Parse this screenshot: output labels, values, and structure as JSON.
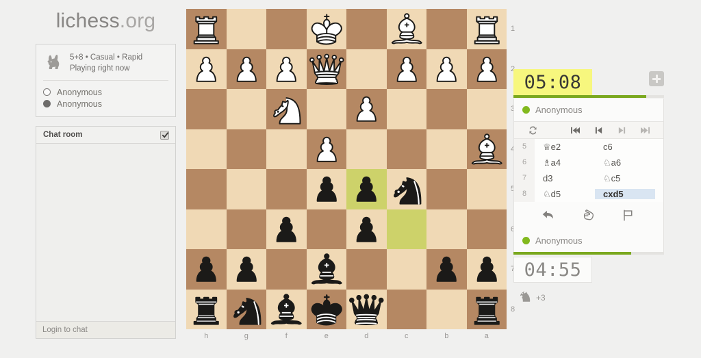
{
  "site": {
    "name_bold": "lichess",
    "name_dim": ".org"
  },
  "game_info": {
    "icon": "rabbit-icon",
    "time_control_line": "5+8 • Casual • Rapid",
    "status_line": "Playing right now",
    "players": [
      {
        "color": "white",
        "name": "Anonymous",
        "dot": "white-circle-icon"
      },
      {
        "color": "black",
        "name": "Anonymous",
        "dot": "black-circle-icon"
      }
    ]
  },
  "chat": {
    "title": "Chat room",
    "toggle_icon": "checkbox-checked-icon",
    "messages": [],
    "login_prompt": "Login to chat"
  },
  "board": {
    "orientation": "black",
    "files": [
      "h",
      "g",
      "f",
      "e",
      "d",
      "c",
      "b",
      "a"
    ],
    "ranks": [
      "1",
      "2",
      "3",
      "4",
      "5",
      "6",
      "7",
      "8"
    ],
    "light_color": "#f0d9b5",
    "dark_color": "#b58863",
    "highlight_color": "#cdd26a",
    "highlighted_squares": [
      "d5",
      "c6"
    ],
    "rows": [
      [
        {
          "sq": "h1",
          "p": "wR"
        },
        {
          "sq": "g1",
          "p": null
        },
        {
          "sq": "f1",
          "p": null
        },
        {
          "sq": "e1",
          "p": "wK"
        },
        {
          "sq": "d1",
          "p": null
        },
        {
          "sq": "c1",
          "p": "wB"
        },
        {
          "sq": "b1",
          "p": null
        },
        {
          "sq": "a1",
          "p": "wR"
        }
      ],
      [
        {
          "sq": "h2",
          "p": "wP"
        },
        {
          "sq": "g2",
          "p": "wP"
        },
        {
          "sq": "f2",
          "p": "wP"
        },
        {
          "sq": "e2",
          "p": "wQ"
        },
        {
          "sq": "d2",
          "p": null
        },
        {
          "sq": "c2",
          "p": "wP"
        },
        {
          "sq": "b2",
          "p": "wP"
        },
        {
          "sq": "a2",
          "p": "wP"
        }
      ],
      [
        {
          "sq": "h3",
          "p": null
        },
        {
          "sq": "g3",
          "p": null
        },
        {
          "sq": "f3",
          "p": "wN"
        },
        {
          "sq": "e3",
          "p": null
        },
        {
          "sq": "d3",
          "p": "wP"
        },
        {
          "sq": "c3",
          "p": null
        },
        {
          "sq": "b3",
          "p": null
        },
        {
          "sq": "a3",
          "p": null
        }
      ],
      [
        {
          "sq": "h4",
          "p": null
        },
        {
          "sq": "g4",
          "p": null
        },
        {
          "sq": "f4",
          "p": null
        },
        {
          "sq": "e4",
          "p": "wP"
        },
        {
          "sq": "d4",
          "p": null
        },
        {
          "sq": "c4",
          "p": null
        },
        {
          "sq": "b4",
          "p": null
        },
        {
          "sq": "a4",
          "p": "wB"
        }
      ],
      [
        {
          "sq": "h5",
          "p": null
        },
        {
          "sq": "g5",
          "p": null
        },
        {
          "sq": "f5",
          "p": null
        },
        {
          "sq": "e5",
          "p": "bP"
        },
        {
          "sq": "d5",
          "p": "bP"
        },
        {
          "sq": "c5",
          "p": "bN"
        },
        {
          "sq": "b5",
          "p": null
        },
        {
          "sq": "a5",
          "p": null
        }
      ],
      [
        {
          "sq": "h6",
          "p": null
        },
        {
          "sq": "g6",
          "p": null
        },
        {
          "sq": "f6",
          "p": "bP"
        },
        {
          "sq": "e6",
          "p": null
        },
        {
          "sq": "d6",
          "p": "bP"
        },
        {
          "sq": "c6",
          "p": null
        },
        {
          "sq": "b6",
          "p": null
        },
        {
          "sq": "a6",
          "p": null
        }
      ],
      [
        {
          "sq": "h7",
          "p": "bP"
        },
        {
          "sq": "g7",
          "p": "bP"
        },
        {
          "sq": "f7",
          "p": null
        },
        {
          "sq": "e7",
          "p": "bB"
        },
        {
          "sq": "d7",
          "p": null
        },
        {
          "sq": "c7",
          "p": null
        },
        {
          "sq": "b7",
          "p": "bP"
        },
        {
          "sq": "a7",
          "p": "bP"
        }
      ],
      [
        {
          "sq": "h8",
          "p": "bR"
        },
        {
          "sq": "g8",
          "p": "bN"
        },
        {
          "sq": "f8",
          "p": "bB"
        },
        {
          "sq": "e8",
          "p": "bK"
        },
        {
          "sq": "d8",
          "p": "bQ"
        },
        {
          "sq": "c8",
          "p": null
        },
        {
          "sq": "b8",
          "p": null
        },
        {
          "sq": "a8",
          "p": "bR"
        }
      ]
    ]
  },
  "clocks": {
    "top": {
      "time": "05:08",
      "state": "running",
      "progress_percent": 88
    },
    "bottom": {
      "time": "04:55",
      "state": "paused",
      "progress_percent": 78
    }
  },
  "add_time_button": {
    "icon": "plus-icon",
    "label": ""
  },
  "opponents": {
    "top": {
      "name": "Anonymous",
      "status": "online"
    },
    "bottom": {
      "name": "Anonymous",
      "status": "online"
    }
  },
  "nav_controls": [
    {
      "name": "flip-board",
      "icon": "flip-board-icon"
    },
    {
      "name": "first-move",
      "icon": "skip-backward-icon"
    },
    {
      "name": "previous-move",
      "icon": "step-backward-icon"
    },
    {
      "name": "next-move",
      "icon": "step-forward-icon"
    },
    {
      "name": "last-move",
      "icon": "skip-forward-icon"
    }
  ],
  "moves": [
    {
      "num": "5",
      "white": "♕e2",
      "black": "c6",
      "active": ""
    },
    {
      "num": "6",
      "white": "♗a4",
      "black": "♘a6",
      "active": ""
    },
    {
      "num": "7",
      "white": "d3",
      "black": "♘c5",
      "active": ""
    },
    {
      "num": "8",
      "white": "♘d5",
      "black": "cxd5",
      "active": "black"
    }
  ],
  "action_buttons": [
    {
      "name": "takeback-button",
      "icon": "undo-arrow-icon"
    },
    {
      "name": "offer-draw-button",
      "icon": "hand-icon"
    },
    {
      "name": "resign-button",
      "icon": "flag-icon"
    }
  ],
  "captured": {
    "piece_icon": "knight-icon",
    "advantage": "+3"
  },
  "colors": {
    "accent_green": "#7aa81e",
    "clock_active_bg": "#f7f77e",
    "move_highlight": "#d9e5f2",
    "board_highlight": "#cdd26a"
  }
}
